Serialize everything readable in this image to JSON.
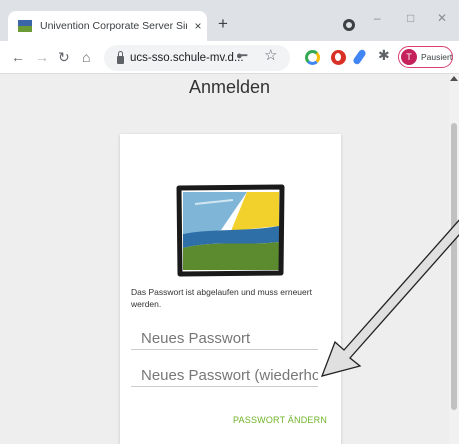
{
  "browser": {
    "tab_title": "Univention Corporate Server Single-Sign-On",
    "tab_close": "×",
    "new_tab": "+",
    "window_controls": {
      "minimize": "–",
      "maximize": "□",
      "close": "✕"
    },
    "nav": {
      "back": "←",
      "forward": "→",
      "reload": "↻",
      "home": "⌂"
    },
    "url": "ucs-sso.schule-mv.d...",
    "profile_initial": "T",
    "profile_status": "Pausiert",
    "icons": [
      "lock-icon",
      "key-icon",
      "star-icon",
      "extension-icon",
      "puzzle-icon",
      "menu-icon"
    ]
  },
  "page": {
    "title": "Anmelden",
    "message": "Das Passwort ist abgelaufen und muss erneuert werden.",
    "new_password_placeholder": "Neues Passwort",
    "repeat_password_placeholder": "Neues Passwort (wiederholen)",
    "submit_label": "PASSWORT ÄNDERN"
  },
  "colors": {
    "accent_green": "#70b32a",
    "tabstrip": "#dee1e6",
    "page_background": "#eeeeee",
    "profile_red": "#c5225b"
  }
}
